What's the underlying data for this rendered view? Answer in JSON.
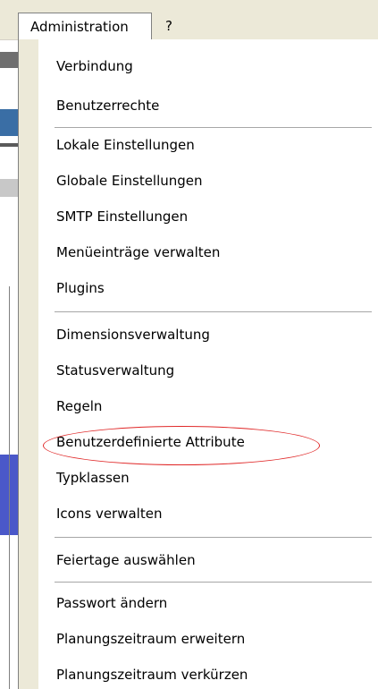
{
  "menubar": {
    "active_menu": "Administration",
    "help_menu": "?"
  },
  "dropdown": {
    "items": [
      "Verbindung",
      "Benutzerrechte",
      "Lokale Einstellungen",
      "Globale Einstellungen",
      "SMTP Einstellungen",
      "Menüeinträge verwalten",
      "Plugins",
      "Dimensionsverwaltung",
      "Statusverwaltung",
      "Regeln",
      "Benutzerdefinierte Attribute",
      "Typklassen",
      "Icons verwalten",
      "Feiertage auswählen",
      "Passwort ändern",
      "Planungszeitraum erweitern",
      "Planungszeitraum verkürzen"
    ],
    "highlighted_item": "Benutzerdefinierte Attribute",
    "highlight_color": "#e02828"
  }
}
